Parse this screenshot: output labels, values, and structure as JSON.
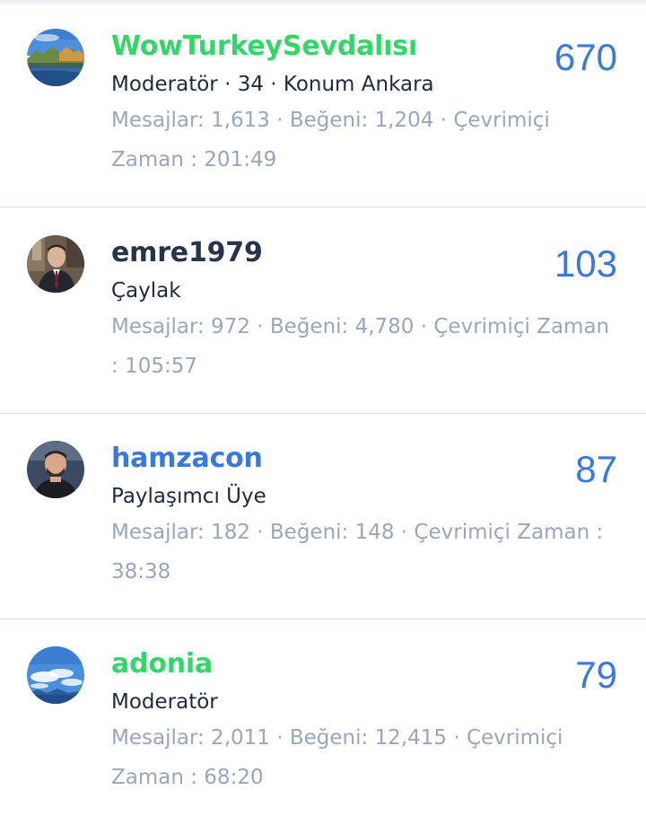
{
  "colors": {
    "moderator_green": "#35d56a",
    "link_blue": "#3978de",
    "dark_name": "#27344a",
    "muted": "#9aa6b9",
    "score_blue": "#3978de"
  },
  "members": [
    {
      "username": "WowTurkeySevdalısı",
      "title": "Moderatör · 34 · Konum Ankara",
      "stats": "Mesajlar: 1,613 · Beğeni: 1,204 · Çevrimiçi Zaman : 201:49",
      "score": "670",
      "name_color": "#35d56a",
      "avatar": "landscape-lake-avatar"
    },
    {
      "username": "emre1979",
      "title": "Çaylak",
      "stats": "Mesajlar: 972 · Beğeni: 4,780 · Çevrimiçi Zaman : 105:57",
      "score": "103",
      "name_color": "#27344a",
      "avatar": "man-in-suit-avatar"
    },
    {
      "username": "hamzacon",
      "title": "Paylaşımcı Üye",
      "stats": "Mesajlar: 182 · Beğeni: 148 · Çevrimiçi Zaman : 38:38",
      "score": "87",
      "name_color": "#3978de",
      "avatar": "man-portrait-avatar"
    },
    {
      "username": "adonia",
      "title": "Moderatör",
      "stats": "Mesajlar: 2,011 · Beğeni: 12,415 · Çevrimiçi Zaman : 68:20",
      "score": "79",
      "name_color": "#35d56a",
      "avatar": "sky-clouds-avatar"
    }
  ]
}
